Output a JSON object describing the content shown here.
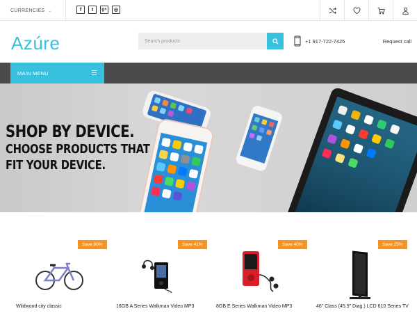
{
  "topbar": {
    "currencies_label": "CURRENCIES",
    "social_icons": [
      "facebook-icon",
      "twitter-icon",
      "google-plus-icon",
      "instagram-icon"
    ],
    "social_glyphs": [
      "f",
      "t",
      "g+",
      "◎"
    ],
    "icons": [
      "shuffle-icon",
      "heart-icon",
      "cart-icon",
      "user-icon"
    ]
  },
  "header": {
    "logo": "Azúre",
    "search_placeholder": "Search products",
    "phone": "+1 917-722-7425",
    "request_call": "Request call"
  },
  "nav": {
    "main_menu_label": "MAIN MENU"
  },
  "hero": {
    "line1": "SHOP BY DEVICE.",
    "line2": "CHOOSE PRODUCTS THAT",
    "line3": "FIT YOUR DEVICE."
  },
  "products": [
    {
      "badge": "Save 80%",
      "name": "Wildwood city classic",
      "icon": "bicycle-image"
    },
    {
      "badge": "Save 41%",
      "name": "16GB A Series Walkman Video MP3",
      "icon": "mp3-player-black-image"
    },
    {
      "badge": "Save 40%",
      "name": "8GB E Series Walkman Video MP3",
      "icon": "mp3-player-red-image"
    },
    {
      "badge": "Save 25%",
      "name": "46\" Class (45.9\" Diag.) LCD 610 Series TV",
      "icon": "tv-image"
    }
  ],
  "colors": {
    "accent": "#39c0dd",
    "badge": "#f7931e",
    "nav_bg": "#4b4b4b"
  }
}
